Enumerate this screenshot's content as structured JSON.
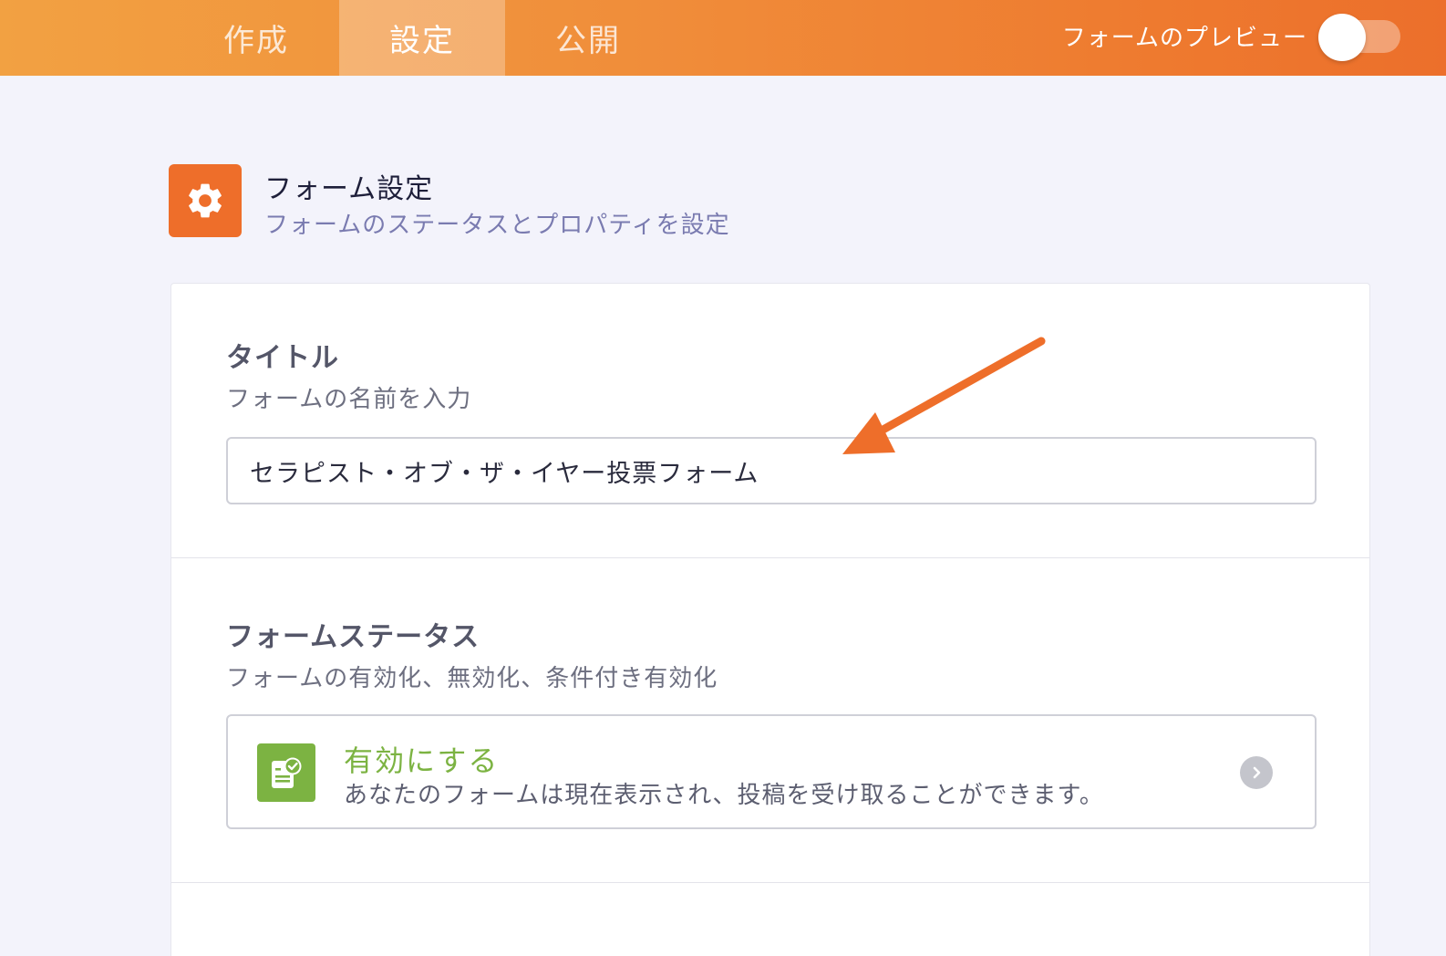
{
  "topbar": {
    "tabs": [
      {
        "label": "作成",
        "active": false
      },
      {
        "label": "設定",
        "active": true
      },
      {
        "label": "公開",
        "active": false
      }
    ],
    "preview_label": "フォームのプレビュー",
    "preview_enabled": false
  },
  "header": {
    "icon": "gear-icon",
    "title": "フォーム設定",
    "subtitle": "フォームのステータスとプロパティを設定"
  },
  "title_section": {
    "heading": "タイトル",
    "description": "フォームの名前を入力",
    "value": "セラピスト・オブ・ザ・イヤー投票フォーム"
  },
  "status_section": {
    "heading": "フォームステータス",
    "description": "フォームの有効化、無効化、条件付き有効化",
    "option": {
      "icon": "form-check-icon",
      "label": "有効にする",
      "text": "あなたのフォームは現在表示され、投稿を受け取ることができます。"
    }
  },
  "colors": {
    "accent": "#ee6e2a",
    "enabled_green": "#7cb342",
    "page_bg": "#f3f3fb"
  }
}
